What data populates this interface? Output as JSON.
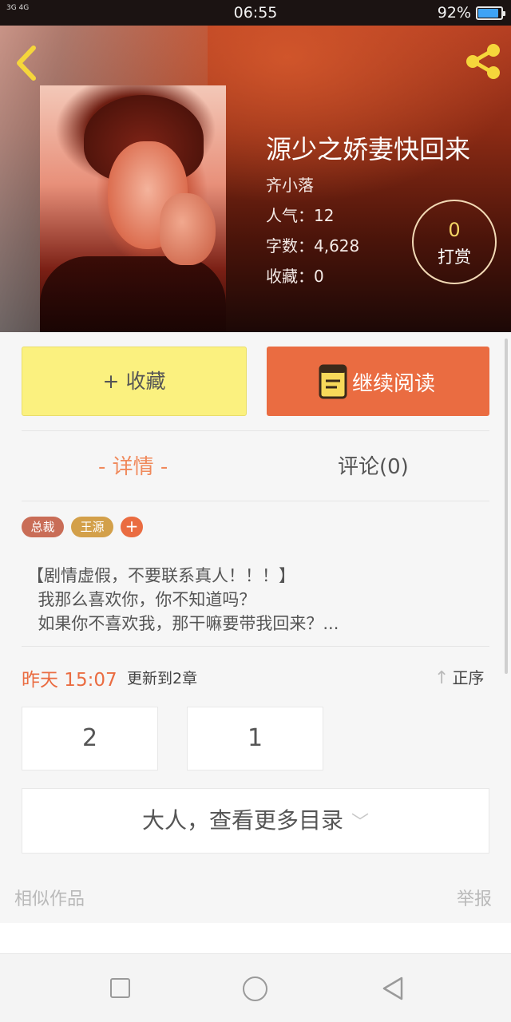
{
  "status_bar": {
    "signal_text": "3G 4G",
    "time": "06:55",
    "battery": "92%"
  },
  "book": {
    "title": "源少之娇妻快回来",
    "author": "齐小落",
    "popularity": "人气：12",
    "word_count": "字数：4,628",
    "favorites": "收藏：0"
  },
  "reward": {
    "count": "0",
    "label": "打赏"
  },
  "actions": {
    "favorite_label": "+ 收藏",
    "continue_label": "继续阅读"
  },
  "tabs": {
    "detail": "- 详情 -",
    "comments": "评论(0)"
  },
  "tags": [
    "总裁",
    "王源"
  ],
  "tag_add": "+",
  "description": [
    "【剧情虚假，不要联系真人！！！】",
    "  我那么喜欢你，你不知道吗？",
    "  如果你不喜欢我，那干嘛要带我回来？..."
  ],
  "update": {
    "time": "昨天 15:07",
    "text": "更新到2章",
    "sort_label": "正序"
  },
  "chapters": [
    "2",
    "1"
  ],
  "more_catalog": "大人，查看更多目录",
  "footer": {
    "similar": "相似作品",
    "report": "举报"
  },
  "colors": {
    "accent_orange": "#ea6c41",
    "favorite_yellow": "#fbf17f",
    "reward_number": "#f5d565"
  },
  "icons": {
    "back": "chevron-left-icon",
    "share": "share-icon",
    "book": "book-icon",
    "sort": "arrow-up-icon",
    "expand": "chevron-down-icon"
  }
}
